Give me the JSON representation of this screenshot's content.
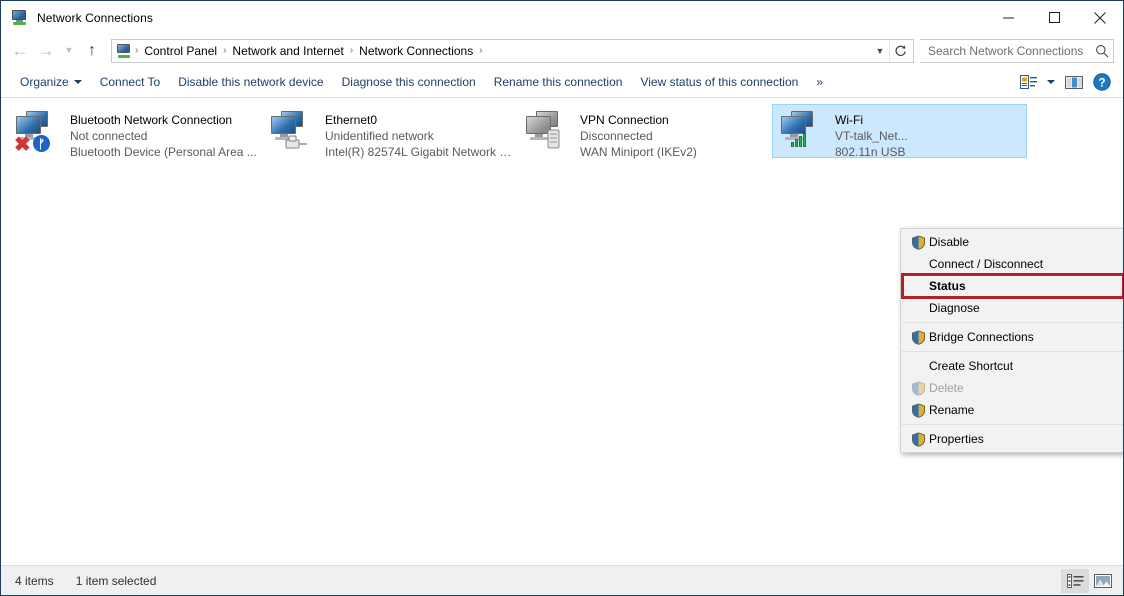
{
  "window": {
    "title": "Network Connections",
    "icon": "network-connections-icon",
    "controls": {
      "minimize": "minimize-icon",
      "maximize": "maximize-icon",
      "close": "close-icon"
    }
  },
  "address_bar": {
    "back": "back-arrow-icon",
    "forward": "forward-arrow-icon",
    "recent": "chevron-down-icon",
    "up": "up-arrow-icon",
    "breadcrumb": [
      "Control Panel",
      "Network and Internet",
      "Network Connections"
    ],
    "separator": "›",
    "dropdown": "chevron-down-icon",
    "refresh": "refresh-icon"
  },
  "search": {
    "placeholder": "Search Network Connections",
    "value": "",
    "icon": "search-icon"
  },
  "toolbar": {
    "items": [
      {
        "label": "Organize",
        "has_caret": true
      },
      {
        "label": "Connect To",
        "has_caret": false
      },
      {
        "label": "Disable this network device",
        "has_caret": false
      },
      {
        "label": "Diagnose this connection",
        "has_caret": false
      },
      {
        "label": "Rename this connection",
        "has_caret": false
      },
      {
        "label": "View status of this connection",
        "has_caret": false
      },
      {
        "label": "»",
        "has_caret": false
      }
    ],
    "change_view_icon": "change-view-icon",
    "change_view_caret": "chevron-down-icon",
    "preview_pane_icon": "preview-pane-icon",
    "help_icon": "help-icon"
  },
  "connections": [
    {
      "name": "Bluetooth Network Connection",
      "status": "Not connected",
      "device": "Bluetooth Device (Personal Area ...",
      "icon": "network-adapter-disabled-icon",
      "badge": "bluetooth-badge",
      "selected": false,
      "enabled": false
    },
    {
      "name": "Ethernet0",
      "status": "Unidentified network",
      "device": "Intel(R) 82574L Gigabit Network C...",
      "icon": "network-adapter-icon",
      "badge": "ethernet-plug-badge",
      "selected": false,
      "enabled": true
    },
    {
      "name": "VPN Connection",
      "status": "Disconnected",
      "device": "WAN Miniport (IKEv2)",
      "icon": "network-adapter-gray-icon",
      "badge": "vpn-server-badge",
      "selected": false,
      "enabled": false
    },
    {
      "name": "Wi-Fi",
      "status": "VT-talk_Net...",
      "device": "802.11n USB",
      "icon": "network-adapter-icon",
      "badge": "wifi-signal-badge",
      "selected": true,
      "enabled": true
    }
  ],
  "context_menu": {
    "items": [
      {
        "label": "Disable",
        "shield": true,
        "disabled": false,
        "bold": false,
        "separator_after": false
      },
      {
        "label": "Connect / Disconnect",
        "shield": false,
        "disabled": false,
        "bold": false,
        "separator_after": false
      },
      {
        "label": "Status",
        "shield": false,
        "disabled": false,
        "bold": true,
        "separator_after": false,
        "highlighted": true
      },
      {
        "label": "Diagnose",
        "shield": false,
        "disabled": false,
        "bold": false,
        "separator_after": true
      },
      {
        "label": "Bridge Connections",
        "shield": true,
        "disabled": false,
        "bold": false,
        "separator_after": true
      },
      {
        "label": "Create Shortcut",
        "shield": false,
        "disabled": false,
        "bold": false,
        "separator_after": false
      },
      {
        "label": "Delete",
        "shield": true,
        "disabled": true,
        "bold": false,
        "separator_after": false
      },
      {
        "label": "Rename",
        "shield": true,
        "disabled": false,
        "bold": false,
        "separator_after": true
      },
      {
        "label": "Properties",
        "shield": true,
        "disabled": false,
        "bold": false,
        "separator_after": false
      }
    ],
    "highlight_color": "#b42026"
  },
  "status_bar": {
    "item_count": "4 items",
    "selection": "1 item selected",
    "details_view_icon": "details-view-icon",
    "large_icons_view_icon": "large-icons-view-icon"
  },
  "colors": {
    "selection_bg": "#cce8ff",
    "selection_border": "#99d1ff",
    "command_link": "#1e3f66",
    "annotation_red": "#b42026",
    "titlebar_border": "#1a3c66"
  }
}
